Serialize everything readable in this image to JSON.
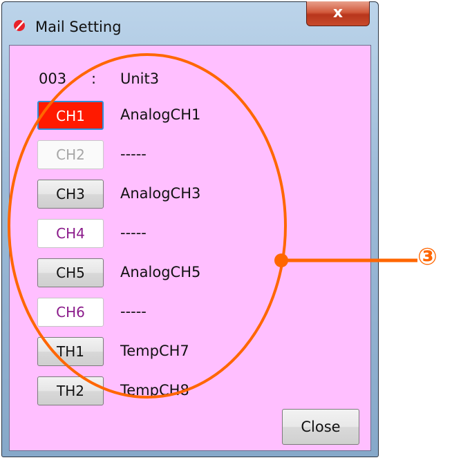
{
  "window": {
    "title": "Mail Setting",
    "close_glyph": "x"
  },
  "header": {
    "unit_number": "003",
    "separator": ":",
    "unit_name": "Unit3"
  },
  "channels": [
    {
      "button": "CH1",
      "name": "AnalogCH1",
      "state": "selected"
    },
    {
      "button": "CH2",
      "name": "-----",
      "state": "disabled"
    },
    {
      "button": "CH3",
      "name": "AnalogCH3",
      "state": "normal"
    },
    {
      "button": "CH4",
      "name": "-----",
      "state": "off"
    },
    {
      "button": "CH5",
      "name": "AnalogCH5",
      "state": "normal"
    },
    {
      "button": "CH6",
      "name": "-----",
      "state": "off"
    },
    {
      "button": "TH1",
      "name": "TempCH7",
      "state": "normal"
    },
    {
      "button": "TH2",
      "name": "TempCH8",
      "state": "normal"
    }
  ],
  "close_button": "Close",
  "annotation": {
    "label": "③",
    "color": "#ff6600"
  },
  "colors": {
    "client_background": "#ffbfff",
    "selected_button": "#ff1a00",
    "off_text": "#8a1a8a"
  },
  "icons": {
    "app": "app-icon",
    "close": "close-icon"
  }
}
